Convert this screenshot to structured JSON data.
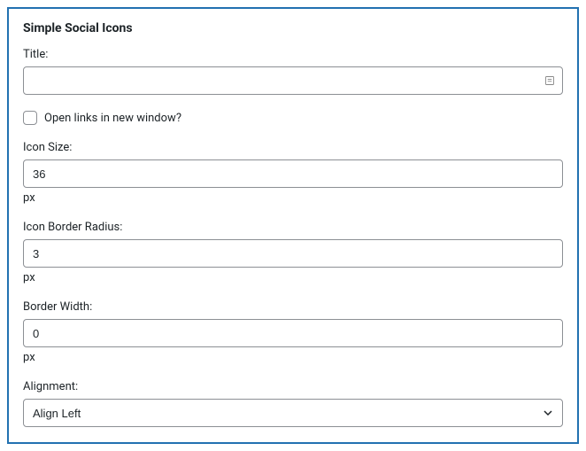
{
  "widget": {
    "title": "Simple Social Icons",
    "fields": {
      "title": {
        "label": "Title:",
        "value": ""
      },
      "new_window": {
        "label": "Open links in new window?",
        "checked": false
      },
      "icon_size": {
        "label": "Icon Size:",
        "value": "36",
        "unit": "px"
      },
      "border_radius": {
        "label": "Icon Border Radius:",
        "value": "3",
        "unit": "px"
      },
      "border_width": {
        "label": "Border Width:",
        "value": "0",
        "unit": "px"
      },
      "alignment": {
        "label": "Alignment:",
        "value": "Align Left"
      }
    }
  }
}
